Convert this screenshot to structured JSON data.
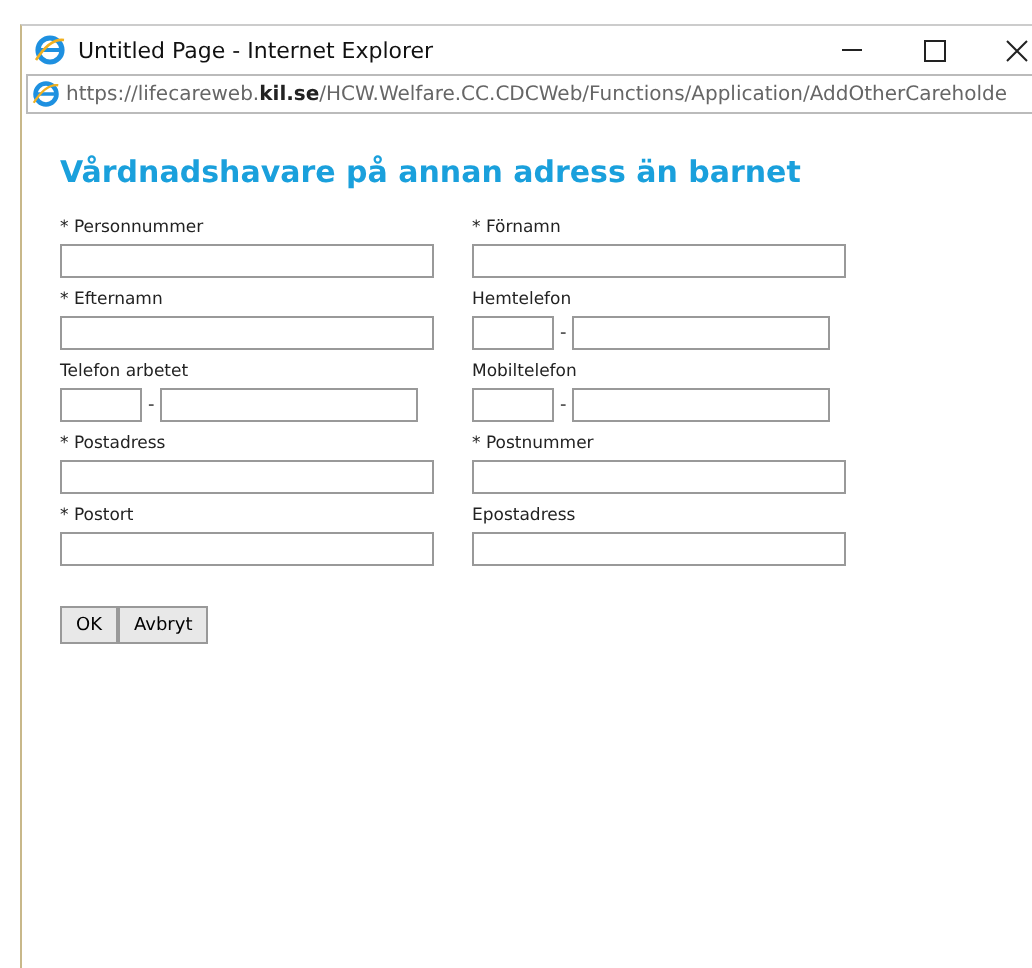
{
  "window": {
    "title": "Untitled Page - Internet Explorer"
  },
  "address_bar": {
    "url": "https://lifecareweb.**kil.se**/HCW.Welfare.CC.CDCWeb/Functions/Application/AddOtherCareholde"
  },
  "heading": "Vårdnadshavare på annan adress än barnet",
  "fields": [
    {
      "label": "* Personnummer",
      "kind": "text"
    },
    {
      "label": "* Förnamn",
      "kind": "text"
    },
    {
      "label": "* Efternamn",
      "kind": "text"
    },
    {
      "label": "Hemtelefon",
      "kind": "phone",
      "separator": "-"
    },
    {
      "label": "Telefon arbetet",
      "kind": "phone",
      "separator": "-"
    },
    {
      "label": "Mobiltelefon",
      "kind": "phone",
      "separator": "-"
    },
    {
      "label": "* Postadress",
      "kind": "text"
    },
    {
      "label": "* Postnummer",
      "kind": "text"
    },
    {
      "label": "* Postort",
      "kind": "text"
    },
    {
      "label": "Epostadress",
      "kind": "text"
    }
  ],
  "buttons": [
    "OK",
    "Avbryt"
  ]
}
